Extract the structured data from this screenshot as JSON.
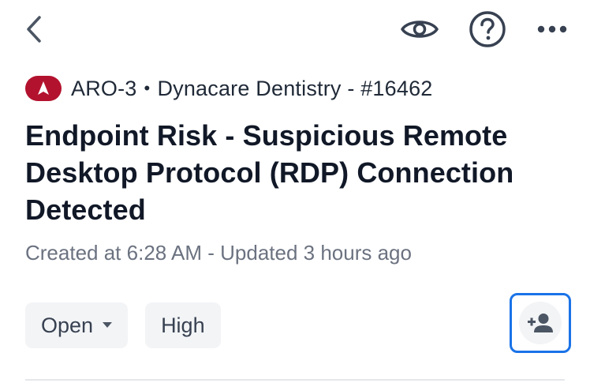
{
  "header": {
    "back_icon": "chevron-left-icon",
    "actions": [
      {
        "icon": "eye-icon"
      },
      {
        "icon": "help-circle-icon"
      },
      {
        "icon": "more-horizontal-icon"
      }
    ]
  },
  "incident": {
    "severity_icon": "alert-badge-icon",
    "severity_color": "#b3122e",
    "id": "ARO-3",
    "separator": "•",
    "org": "Dynacare Dentistry - #16462",
    "title": "Endpoint Risk - Suspicious Remote Desktop Protocol (RDP) Connection Detected",
    "subtitle": "Created at 6:28 AM - Updated 3 hours ago"
  },
  "chips": {
    "status": "Open",
    "priority": "High"
  },
  "assign": {
    "icon": "add-person-icon",
    "focus_color": "#1a73e8"
  }
}
